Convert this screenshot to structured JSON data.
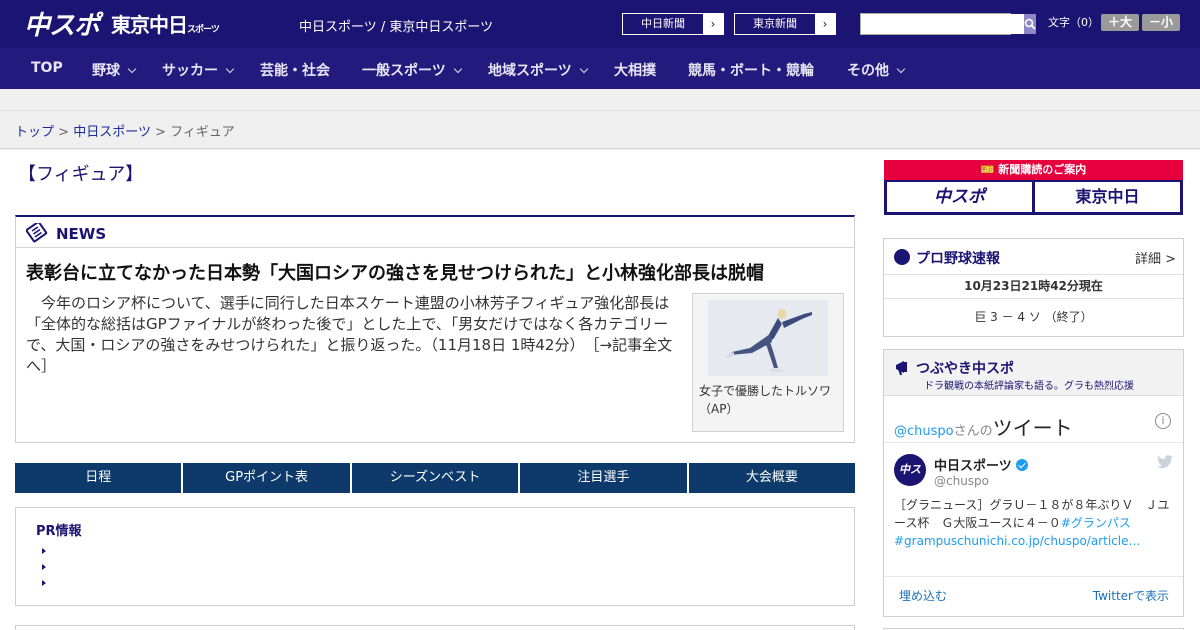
{
  "header": {
    "logo_main": "中スポ",
    "logo_sub": "東京中日",
    "logo_sub_small": "スポーツ",
    "tagline": "中日スポーツ / 東京中日スポーツ",
    "newspaper_buttons": [
      "中日新聞",
      "東京新聞"
    ],
    "search_placeholder": "",
    "font_size_label": "文字（0）",
    "font_plus": "＋大",
    "font_minus": "－小"
  },
  "nav": {
    "items": [
      {
        "label": "TOP",
        "has_dropdown": false
      },
      {
        "label": "野球",
        "has_dropdown": true
      },
      {
        "label": "サッカー",
        "has_dropdown": true
      },
      {
        "label": "芸能・社会",
        "has_dropdown": false
      },
      {
        "label": "一般スポーツ",
        "has_dropdown": true
      },
      {
        "label": "地域スポーツ",
        "has_dropdown": true
      },
      {
        "label": "大相撲",
        "has_dropdown": false
      },
      {
        "label": "競馬・ボート・競輪",
        "has_dropdown": false
      },
      {
        "label": "その他",
        "has_dropdown": true
      }
    ]
  },
  "breadcrumb": {
    "items": [
      "トップ",
      "中日スポーツ",
      "フィギュア"
    ],
    "separator": ">"
  },
  "page_title": "【フィギュア】",
  "news": {
    "label": "NEWS",
    "headline": "表彰台に立てなかった日本勢「大国ロシアの強さを見せつけられた」と小林強化部長は脱帽",
    "body": "今年のロシア杯について、選手に同行した日本スケート連盟の小林芳子フィギュア強化部長は「全体的な総括はGPファイナルが終わった後で」とした上で、「男女だけではなく各カテゴリーで、大国・ロシアの強さをみせつけられた」と振り返った。（11月18日 1時42分）",
    "more_link": "［→記事全文へ］",
    "photo_caption": "女子で優勝したトルソワ（AP）"
  },
  "tabs": [
    "日程",
    "GPポイント表",
    "シーズンベスト",
    "注目選手",
    "大会概要"
  ],
  "pr": {
    "title": "PR情報"
  },
  "sidebar": {
    "subscription": {
      "top": "新聞購読のご案内",
      "btn_left": "中スポ",
      "btn_right": "東京中日"
    },
    "baseball": {
      "title": "プロ野球速報",
      "more": "詳細 >",
      "time": "10月23日21時42分現在",
      "score": "巨 3 － 4 ソ （終了）"
    },
    "tsubuyaki": {
      "title": "つぶやき中スポ",
      "subtitle": "ドラ観戦の本紙評論家も語る。グラも熱烈応援",
      "by_handle": "@chuspo",
      "by_san": "さんの",
      "by_tweet": "ツイート",
      "account_name": "中日スポーツ",
      "account_handle": "@chuspo",
      "tweet_text": "［グラニュース］グラＵ－１８が８年ぶりＶ　Ｊユース杯　Ｇ大阪ユースに４－０",
      "tweet_hashtag": "#グランパス",
      "tweet_link": "#grampuschunichi.co.jp/chuspo/article…",
      "embed": "埋め込む",
      "view_on_twitter": "Twitterで表示"
    }
  },
  "colors": {
    "brand_navy": "#1c1472",
    "tab_blue": "#0d3a6b",
    "subscription_red": "#e6003e",
    "twitter_blue": "#1d9bf0"
  }
}
